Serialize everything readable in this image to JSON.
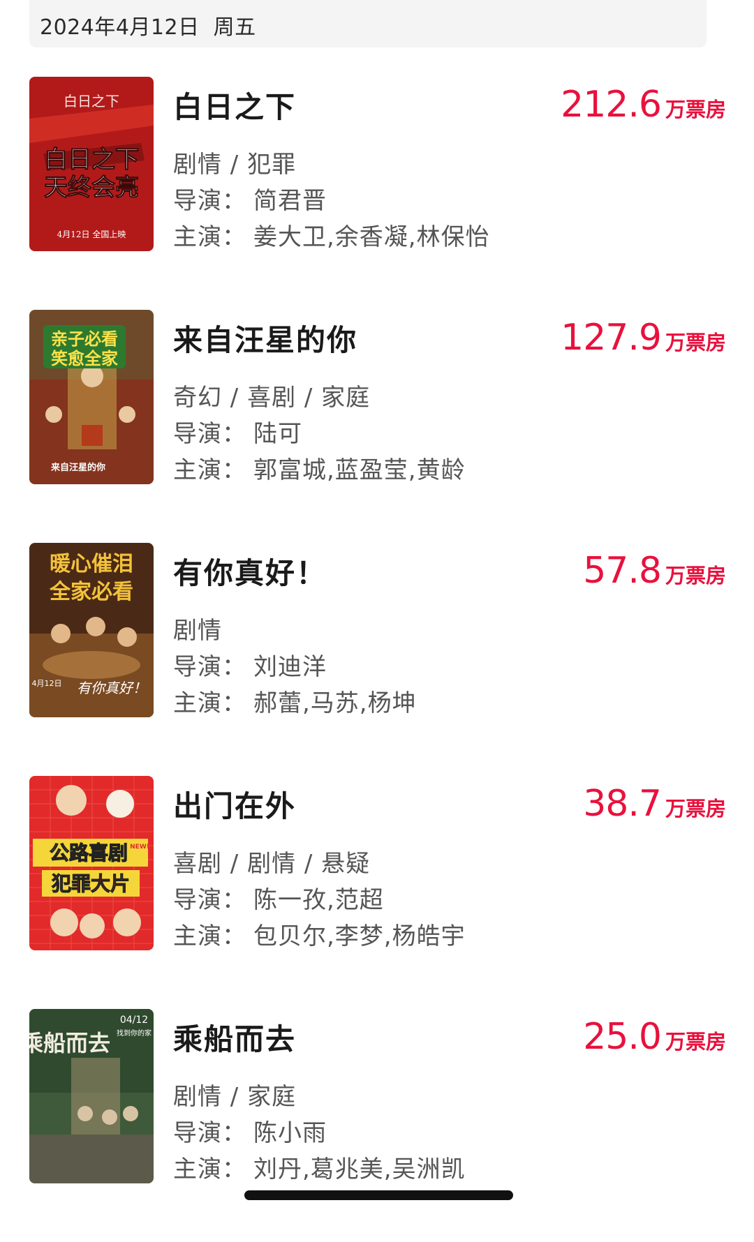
{
  "date": {
    "text": "2024年4月12日  周五"
  },
  "labels": {
    "director": "导演：",
    "cast": "主演：",
    "box_unit": "万票房"
  },
  "colors": {
    "box_office": "#e8113d",
    "date_bar_bg": "#f4f4f4"
  },
  "movies": [
    {
      "title": "白日之下",
      "box_office": "212.6",
      "genres": "剧情 / 犯罪",
      "director": "简君晋",
      "cast": "姜大卫,余香凝,林保怡",
      "poster": {
        "line1": "白日之下",
        "line2": "天终会亮",
        "top": "白日之下",
        "bottom": "4月12日 全国上映"
      }
    },
    {
      "title": "来自汪星的你",
      "box_office": "127.9",
      "genres": "奇幻 / 喜剧 / 家庭",
      "director": "陆可",
      "cast": "郭富城,蓝盈莹,黄龄",
      "poster": {
        "line1": "亲子必看",
        "line2": "笑愈全家",
        "bottom": "来自汪星的你"
      }
    },
    {
      "title": "有你真好！",
      "box_office": "57.8",
      "genres": "剧情",
      "director": "刘迪洋",
      "cast": "郝蕾,马苏,杨坤",
      "poster": {
        "line1": "暖心催泪",
        "line2": "全家必看",
        "bottom": "有你真好！",
        "date": "4月12日"
      }
    },
    {
      "title": "出门在外",
      "box_office": "38.7",
      "genres": "喜剧 / 剧情 / 悬疑",
      "director": "陈一孜,范超",
      "cast": "包贝尔,李梦,杨皓宇",
      "poster": {
        "line1": "公路喜剧",
        "line2": "犯罪大片",
        "badge": "NEW!"
      }
    },
    {
      "title": "乘船而去",
      "box_office": "25.0",
      "genres": "剧情 / 家庭",
      "director": "陈小雨",
      "cast": "刘丹,葛兆美,吴洲凯",
      "poster": {
        "line1": "乘船而去",
        "date": "04/12",
        "sub": "找到你的家"
      }
    }
  ]
}
